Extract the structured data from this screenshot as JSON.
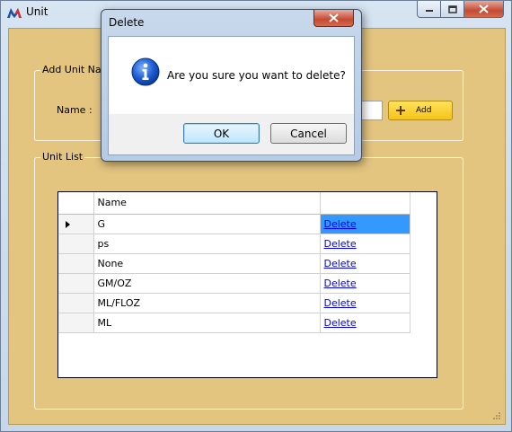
{
  "window": {
    "title": "Unit",
    "icon": "app-logo-icon",
    "controls": [
      "minimize-icon",
      "maximize-icon",
      "close-icon"
    ]
  },
  "add_group": {
    "legend": "Add Unit Name",
    "name_label": "Name :",
    "name_value": "",
    "add_button": "Add"
  },
  "list_group": {
    "legend": "Unit List",
    "columns": [
      "Name",
      ""
    ],
    "rows": [
      {
        "name": "G",
        "action": "Delete"
      },
      {
        "name": "ps",
        "action": "Delete"
      },
      {
        "name": "None",
        "action": "Delete"
      },
      {
        "name": "GM/OZ",
        "action": "Delete"
      },
      {
        "name": "ML/FLOZ",
        "action": "Delete"
      },
      {
        "name": "ML",
        "action": "Delete"
      }
    ],
    "selected_row": 0
  },
  "dialog": {
    "title": "Delete",
    "message": "Are you sure you want to delete?",
    "ok": "OK",
    "cancel": "Cancel",
    "icon": "info-icon"
  },
  "colors": {
    "client_bg": "#e3c57f",
    "add_button": "#f4c318",
    "selection": "#3399ff",
    "link": "#0000ff"
  }
}
